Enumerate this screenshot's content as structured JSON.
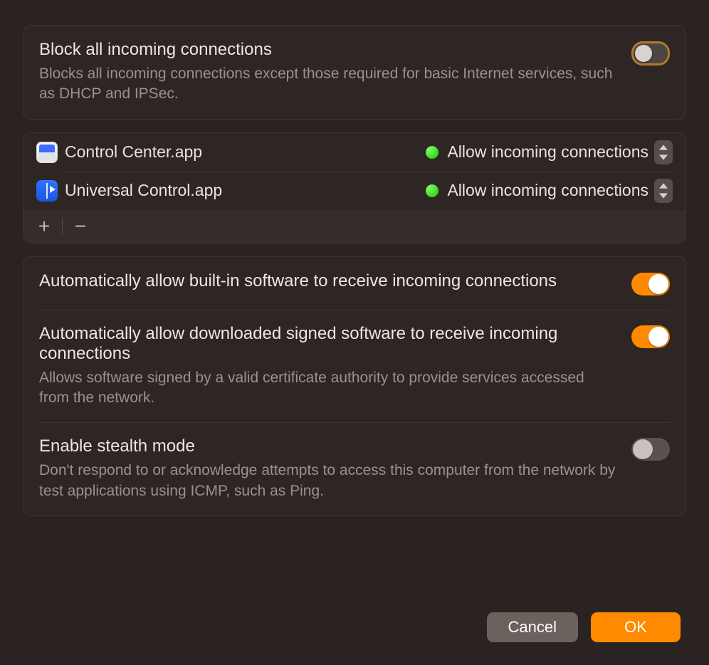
{
  "block_all": {
    "title": "Block all incoming connections",
    "subtitle": "Blocks all incoming connections except those required for basic Internet services, such as DHCP and IPSec.",
    "on": false
  },
  "apps": [
    {
      "icon": "control-center-icon",
      "name": "Control Center.app",
      "status_label": "Allow incoming connections",
      "status_color": "#1ec400"
    },
    {
      "icon": "universal-control-icon",
      "name": "Universal Control.app",
      "status_label": "Allow incoming connections",
      "status_color": "#1ec400"
    }
  ],
  "list_buttons": {
    "add": "+",
    "remove": "−"
  },
  "options": [
    {
      "key": "auto_builtin",
      "title": "Automatically allow built-in software to receive incoming connections",
      "subtitle": "",
      "on": true
    },
    {
      "key": "auto_signed",
      "title": "Automatically allow downloaded signed software to receive incoming connections",
      "subtitle": "Allows software signed by a valid certificate authority to provide services accessed from the network.",
      "on": true
    },
    {
      "key": "stealth",
      "title": "Enable stealth mode",
      "subtitle": "Don't respond to or acknowledge attempts to access this computer from the network by test applications using ICMP, such as Ping.",
      "on": false
    }
  ],
  "footer": {
    "cancel": "Cancel",
    "ok": "OK"
  }
}
